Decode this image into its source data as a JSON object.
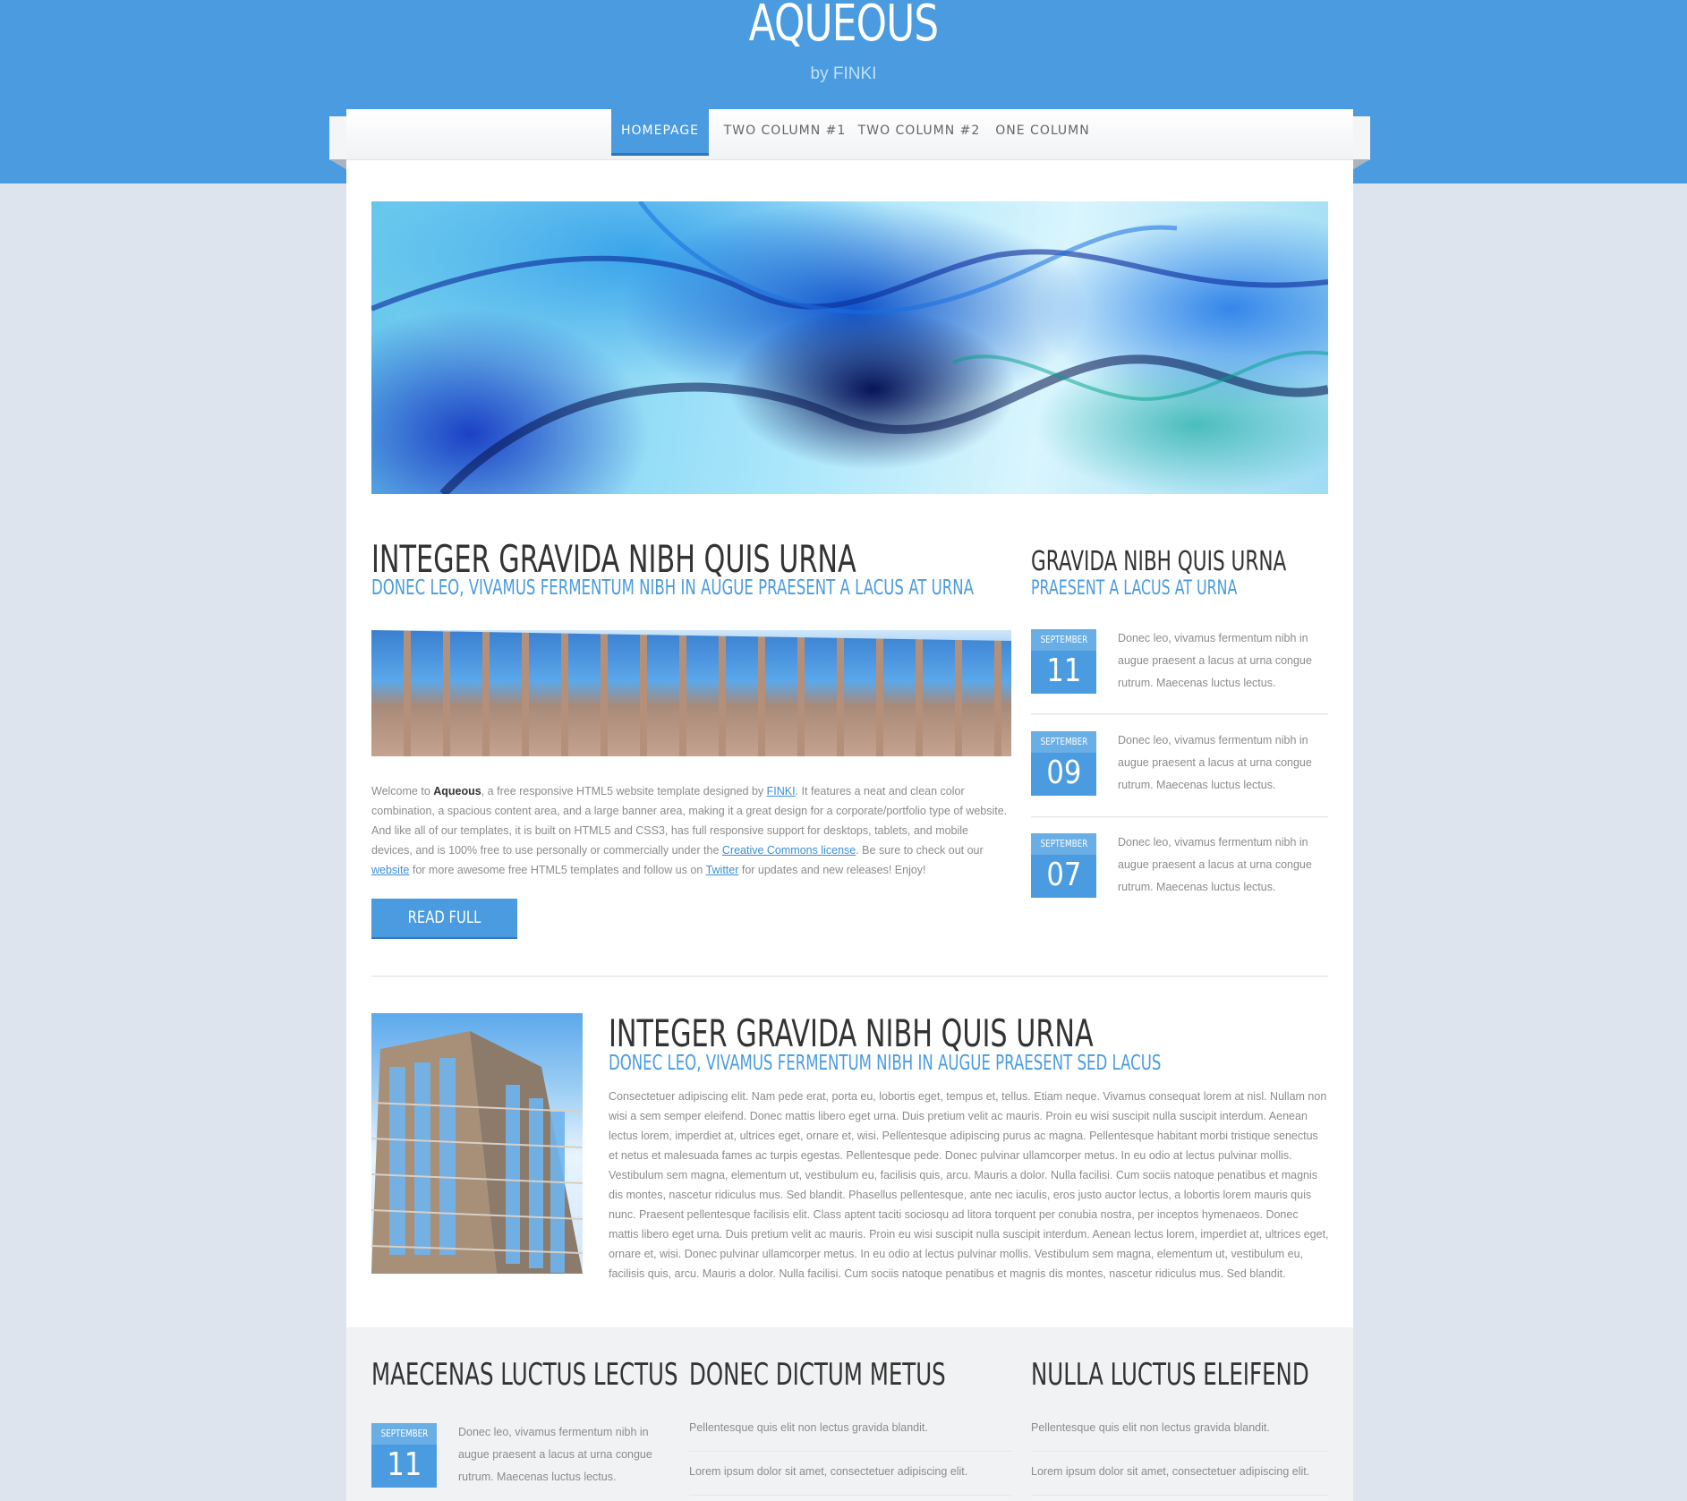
{
  "site": {
    "title": "AQUEOUS",
    "byline": "by FINKI"
  },
  "nav": {
    "items": [
      {
        "label": "HOMEPAGE",
        "active": true
      },
      {
        "label": "TWO COLUMN #1",
        "active": false
      },
      {
        "label": "TWO COLUMN #2",
        "active": false
      },
      {
        "label": "ONE COLUMN",
        "active": false
      }
    ]
  },
  "article1": {
    "title": "INTEGER GRAVIDA NIBH QUIS URNA",
    "subtitle": "DONEC LEO, VIVAMUS FERMENTUM NIBH IN AUGUE PRAESENT A LACUS AT URNA",
    "t1": "Welcome to ",
    "brand": "Aqueous",
    "t2": ", a free responsive HTML5 website template designed by ",
    "link_finki": "FINKI",
    "t3": ". It features a neat and clean color combination, a spacious content area, and a large banner area, making it a great design for a corporate/portfolio type of website. And like all of our templates, it is built on HTML5 and CSS3, has full responsive support for desktops, tablets, and mobile devices, and is 100% free to use personally or commercially under the ",
    "link_cc": "Creative Commons license",
    "t4": ". Be sure to check out our ",
    "link_website": "website",
    "t5": " for more awesome free HTML5 templates and follow us on ",
    "link_twitter": "Twitter",
    "t6": " for updates and new releases! Enjoy!",
    "button": "READ FULL ARTICLE"
  },
  "sidebar": {
    "title": "GRAVIDA NIBH QUIS URNA",
    "subtitle": "PRAESENT A LACUS AT URNA",
    "posts": [
      {
        "month": "SEPTEMBER",
        "day": "11",
        "text": "Donec leo, vivamus fermentum nibh in augue praesent a lacus at urna congue rutrum. Maecenas luctus lectus."
      },
      {
        "month": "SEPTEMBER",
        "day": "09",
        "text": "Donec leo, vivamus fermentum nibh in augue praesent a lacus at urna congue rutrum. Maecenas luctus lectus."
      },
      {
        "month": "SEPTEMBER",
        "day": "07",
        "text": "Donec leo, vivamus fermentum nibh in augue praesent a lacus at urna congue rutrum. Maecenas luctus lectus."
      }
    ]
  },
  "article2": {
    "title": "INTEGER GRAVIDA NIBH QUIS URNA",
    "subtitle": "DONEC LEO, VIVAMUS FERMENTUM NIBH IN AUGUE PRAESENT SED LACUS",
    "body": "Consectetuer adipiscing elit. Nam pede erat, porta eu, lobortis eget, tempus et, tellus. Etiam neque. Vivamus consequat lorem at nisl. Nullam non wisi a sem semper eleifend. Donec mattis libero eget urna. Duis pretium velit ac mauris. Proin eu wisi suscipit nulla suscipit interdum. Aenean lectus lorem, imperdiet at, ultrices eget, ornare et, wisi. Pellentesque adipiscing purus ac magna. Pellentesque habitant morbi tristique senectus et netus et malesuada fames ac turpis egestas. Pellentesque pede. Donec pulvinar ullamcorper metus. In eu odio at lectus pulvinar mollis. Vestibulum sem magna, elementum ut, vestibulum eu, facilisis quis, arcu. Mauris a dolor. Nulla facilisi. Cum sociis natoque penatibus et magnis dis montes, nascetur ridiculus mus. Sed blandit. Phasellus pellentesque, ante nec iaculis, eros justo auctor lectus, a lobortis lorem mauris quis nunc. Praesent pellentesque facilisis elit. Class aptent taciti sociosqu ad litora torquent per conubia nostra, per inceptos hymenaeos. Donec mattis libero eget urna. Duis pretium velit ac mauris. Proin eu wisi suscipit nulla suscipit interdum. Aenean lectus lorem, imperdiet at, ultrices eget, ornare et, wisi. Donec pulvinar ullamcorper metus. In eu odio at lectus pulvinar mollis. Vestibulum sem magna, elementum ut, vestibulum eu, facilisis quis, arcu. Mauris a dolor. Nulla facilisi. Cum sociis natoque penatibus et magnis dis montes, nascetur ridiculus mus. Sed blandit."
  },
  "footer": {
    "col1": {
      "title": "MAECENAS LUCTUS LECTUS",
      "month": "SEPTEMBER",
      "day": "11",
      "text": "Donec leo, vivamus fermentum nibh in augue praesent a lacus at urna congue rutrum. Maecenas luctus lectus."
    },
    "col2": {
      "title": "DONEC DICTUM METUS",
      "items": [
        "Pellentesque quis elit non lectus gravida blandit.",
        "Lorem ipsum dolor sit amet, consectetuer adipiscing elit."
      ]
    },
    "col3": {
      "title": "NULLA LUCTUS ELEIFEND",
      "items": [
        "Pellentesque quis elit non lectus gravida blandit.",
        "Lorem ipsum dolor sit amet, consectetuer adipiscing elit."
      ]
    }
  },
  "colors": {
    "accent": "#4a9be0",
    "accent_dark": "#2f77bb",
    "background": "#dde4ee",
    "heading": "#333333",
    "body_text": "#8c8c8c"
  }
}
